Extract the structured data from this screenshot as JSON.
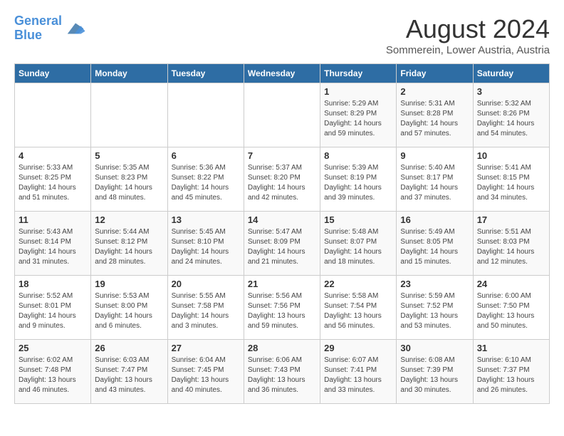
{
  "header": {
    "logo_line1": "General",
    "logo_line2": "Blue",
    "month_title": "August 2024",
    "subtitle": "Sommerein, Lower Austria, Austria"
  },
  "days_of_week": [
    "Sunday",
    "Monday",
    "Tuesday",
    "Wednesday",
    "Thursday",
    "Friday",
    "Saturday"
  ],
  "weeks": [
    [
      {
        "day": "",
        "info": ""
      },
      {
        "day": "",
        "info": ""
      },
      {
        "day": "",
        "info": ""
      },
      {
        "day": "",
        "info": ""
      },
      {
        "day": "1",
        "info": "Sunrise: 5:29 AM\nSunset: 8:29 PM\nDaylight: 14 hours\nand 59 minutes."
      },
      {
        "day": "2",
        "info": "Sunrise: 5:31 AM\nSunset: 8:28 PM\nDaylight: 14 hours\nand 57 minutes."
      },
      {
        "day": "3",
        "info": "Sunrise: 5:32 AM\nSunset: 8:26 PM\nDaylight: 14 hours\nand 54 minutes."
      }
    ],
    [
      {
        "day": "4",
        "info": "Sunrise: 5:33 AM\nSunset: 8:25 PM\nDaylight: 14 hours\nand 51 minutes."
      },
      {
        "day": "5",
        "info": "Sunrise: 5:35 AM\nSunset: 8:23 PM\nDaylight: 14 hours\nand 48 minutes."
      },
      {
        "day": "6",
        "info": "Sunrise: 5:36 AM\nSunset: 8:22 PM\nDaylight: 14 hours\nand 45 minutes."
      },
      {
        "day": "7",
        "info": "Sunrise: 5:37 AM\nSunset: 8:20 PM\nDaylight: 14 hours\nand 42 minutes."
      },
      {
        "day": "8",
        "info": "Sunrise: 5:39 AM\nSunset: 8:19 PM\nDaylight: 14 hours\nand 39 minutes."
      },
      {
        "day": "9",
        "info": "Sunrise: 5:40 AM\nSunset: 8:17 PM\nDaylight: 14 hours\nand 37 minutes."
      },
      {
        "day": "10",
        "info": "Sunrise: 5:41 AM\nSunset: 8:15 PM\nDaylight: 14 hours\nand 34 minutes."
      }
    ],
    [
      {
        "day": "11",
        "info": "Sunrise: 5:43 AM\nSunset: 8:14 PM\nDaylight: 14 hours\nand 31 minutes."
      },
      {
        "day": "12",
        "info": "Sunrise: 5:44 AM\nSunset: 8:12 PM\nDaylight: 14 hours\nand 28 minutes."
      },
      {
        "day": "13",
        "info": "Sunrise: 5:45 AM\nSunset: 8:10 PM\nDaylight: 14 hours\nand 24 minutes."
      },
      {
        "day": "14",
        "info": "Sunrise: 5:47 AM\nSunset: 8:09 PM\nDaylight: 14 hours\nand 21 minutes."
      },
      {
        "day": "15",
        "info": "Sunrise: 5:48 AM\nSunset: 8:07 PM\nDaylight: 14 hours\nand 18 minutes."
      },
      {
        "day": "16",
        "info": "Sunrise: 5:49 AM\nSunset: 8:05 PM\nDaylight: 14 hours\nand 15 minutes."
      },
      {
        "day": "17",
        "info": "Sunrise: 5:51 AM\nSunset: 8:03 PM\nDaylight: 14 hours\nand 12 minutes."
      }
    ],
    [
      {
        "day": "18",
        "info": "Sunrise: 5:52 AM\nSunset: 8:01 PM\nDaylight: 14 hours\nand 9 minutes."
      },
      {
        "day": "19",
        "info": "Sunrise: 5:53 AM\nSunset: 8:00 PM\nDaylight: 14 hours\nand 6 minutes."
      },
      {
        "day": "20",
        "info": "Sunrise: 5:55 AM\nSunset: 7:58 PM\nDaylight: 14 hours\nand 3 minutes."
      },
      {
        "day": "21",
        "info": "Sunrise: 5:56 AM\nSunset: 7:56 PM\nDaylight: 13 hours\nand 59 minutes."
      },
      {
        "day": "22",
        "info": "Sunrise: 5:58 AM\nSunset: 7:54 PM\nDaylight: 13 hours\nand 56 minutes."
      },
      {
        "day": "23",
        "info": "Sunrise: 5:59 AM\nSunset: 7:52 PM\nDaylight: 13 hours\nand 53 minutes."
      },
      {
        "day": "24",
        "info": "Sunrise: 6:00 AM\nSunset: 7:50 PM\nDaylight: 13 hours\nand 50 minutes."
      }
    ],
    [
      {
        "day": "25",
        "info": "Sunrise: 6:02 AM\nSunset: 7:48 PM\nDaylight: 13 hours\nand 46 minutes."
      },
      {
        "day": "26",
        "info": "Sunrise: 6:03 AM\nSunset: 7:47 PM\nDaylight: 13 hours\nand 43 minutes."
      },
      {
        "day": "27",
        "info": "Sunrise: 6:04 AM\nSunset: 7:45 PM\nDaylight: 13 hours\nand 40 minutes."
      },
      {
        "day": "28",
        "info": "Sunrise: 6:06 AM\nSunset: 7:43 PM\nDaylight: 13 hours\nand 36 minutes."
      },
      {
        "day": "29",
        "info": "Sunrise: 6:07 AM\nSunset: 7:41 PM\nDaylight: 13 hours\nand 33 minutes."
      },
      {
        "day": "30",
        "info": "Sunrise: 6:08 AM\nSunset: 7:39 PM\nDaylight: 13 hours\nand 30 minutes."
      },
      {
        "day": "31",
        "info": "Sunrise: 6:10 AM\nSunset: 7:37 PM\nDaylight: 13 hours\nand 26 minutes."
      }
    ]
  ]
}
